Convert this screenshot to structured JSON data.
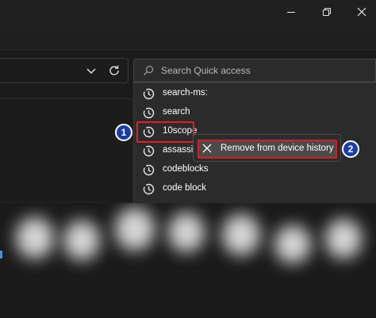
{
  "title_bar": {
    "minimize_icon": "minimize-icon",
    "restore_icon": "restore-icon",
    "close_icon": "close-icon"
  },
  "toolbar": {
    "address_dropdown_icon": "chevron-down-icon",
    "refresh_icon": "refresh-icon"
  },
  "search": {
    "placeholder": "Search Quick access",
    "icon": "search-icon"
  },
  "history": {
    "items": [
      {
        "label": "search-ms:",
        "icon": "history-icon"
      },
      {
        "label": "search",
        "icon": "history-icon"
      },
      {
        "label": "10scope",
        "icon": "history-icon"
      },
      {
        "label": "assassins",
        "icon": "history-icon"
      },
      {
        "label": "codeblocks",
        "icon": "history-icon"
      },
      {
        "label": "code block",
        "icon": "history-icon"
      }
    ]
  },
  "context_menu": {
    "remove_label": "Remove from device history",
    "remove_icon": "close-icon"
  },
  "steps": {
    "one": "1",
    "two": "2"
  },
  "colors": {
    "highlight": "#e0202a",
    "badge": "#1a3ea8",
    "menu_bg": "#2b2b2b"
  }
}
